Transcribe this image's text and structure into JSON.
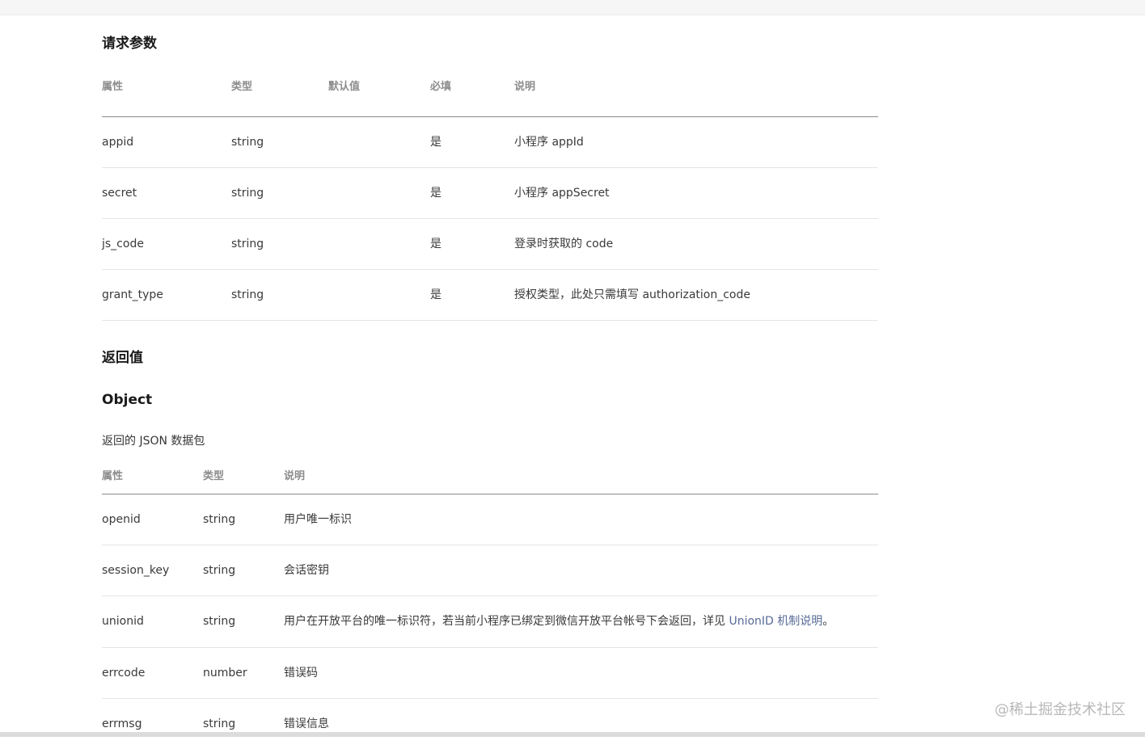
{
  "request_section": {
    "title": "请求参数",
    "headers": [
      "属性",
      "类型",
      "默认值",
      "必填",
      "说明"
    ],
    "rows": [
      {
        "name": "appid",
        "type": "string",
        "default": "",
        "required": "是",
        "desc": "小程序 appId"
      },
      {
        "name": "secret",
        "type": "string",
        "default": "",
        "required": "是",
        "desc": "小程序 appSecret"
      },
      {
        "name": "js_code",
        "type": "string",
        "default": "",
        "required": "是",
        "desc": "登录时获取的 code"
      },
      {
        "name": "grant_type",
        "type": "string",
        "default": "",
        "required": "是",
        "desc": "授权类型，此处只需填写 authorization_code"
      }
    ]
  },
  "return_section": {
    "title": "返回值",
    "object_title": "Object",
    "object_desc": "返回的 JSON 数据包",
    "headers": [
      "属性",
      "类型",
      "说明"
    ],
    "rows": [
      {
        "name": "openid",
        "type": "string",
        "desc": "用户唯一标识"
      },
      {
        "name": "session_key",
        "type": "string",
        "desc": "会话密钥"
      },
      {
        "name": "unionid",
        "type": "string",
        "desc": "用户在开放平台的唯一标识符，若当前小程序已绑定到微信开放平台帐号下会返回，详见 ",
        "link": "UnionID 机制说明",
        "suffix": "。"
      },
      {
        "name": "errcode",
        "type": "number",
        "desc": "错误码"
      },
      {
        "name": "errmsg",
        "type": "string",
        "desc": "错误信息"
      }
    ]
  },
  "watermark": "@稀土掘金技术社区",
  "colors": {
    "link": "#576b95",
    "header_text": "#8c8c8c",
    "body_text": "#3a3a3a"
  }
}
